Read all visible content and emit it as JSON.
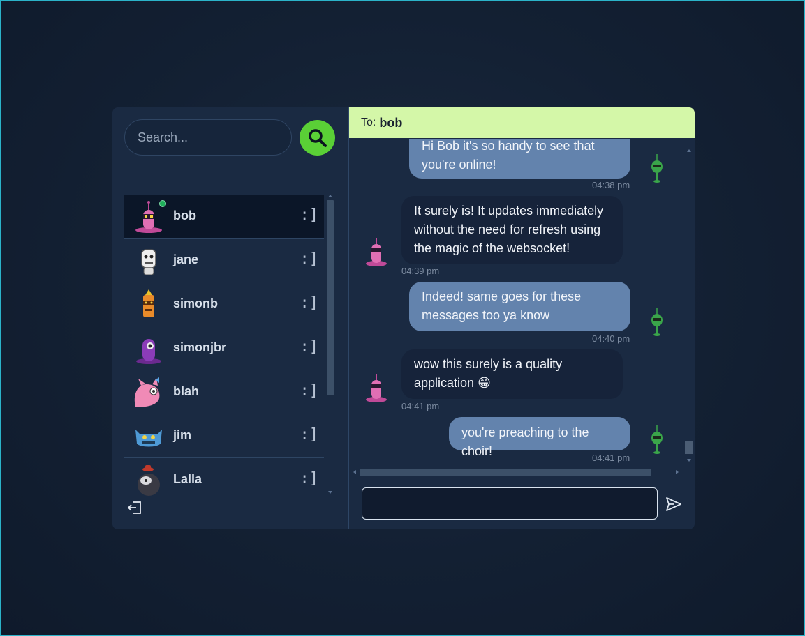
{
  "search": {
    "placeholder": "Search..."
  },
  "contacts": [
    {
      "name": "bob",
      "status": ":]",
      "online": true,
      "active": true
    },
    {
      "name": "jane",
      "status": ":]"
    },
    {
      "name": "simonb",
      "status": ":]"
    },
    {
      "name": "simonjbr",
      "status": ":]"
    },
    {
      "name": "blah",
      "status": ":]"
    },
    {
      "name": "jim",
      "status": ":]"
    },
    {
      "name": "Lalla",
      "status": ":]"
    }
  ],
  "chat": {
    "to_label": "To:",
    "to_name": "bob",
    "messages": [
      {
        "dir": "out",
        "lines": [
          "Hi Bob it's so handy to see that",
          "you're online!"
        ],
        "time": "04:38 pm"
      },
      {
        "dir": "in",
        "lines": [
          "It surely is! It updates immediately",
          "without the need for refresh using",
          "the magic of the websocket!"
        ],
        "time": "04:39 pm"
      },
      {
        "dir": "out",
        "lines": [
          "Indeed! same goes for these",
          "messages too ya know"
        ],
        "time": "04:40 pm"
      },
      {
        "dir": "in",
        "lines": [
          "wow this surely is a quality",
          "application 😁"
        ],
        "time": "04:41 pm"
      },
      {
        "dir": "out",
        "lines": [
          "you're preaching to the choir!"
        ],
        "time": "04:41 pm"
      }
    ],
    "compose_value": ""
  },
  "colors": {
    "accent_green": "#5ad036",
    "to_bar": "#d4f7a8",
    "outgoing_bubble": "#6383ad",
    "incoming_bubble": "#16233a",
    "online": "#1fae5a"
  },
  "icons": {
    "search": "magnifier-icon",
    "logout": "logout-icon",
    "send": "paper-plane-icon"
  }
}
